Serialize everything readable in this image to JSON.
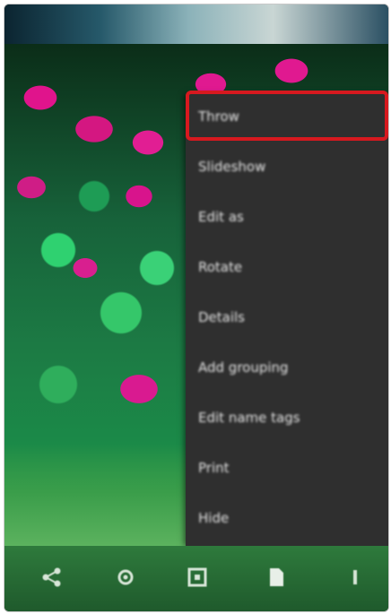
{
  "menu": {
    "items": [
      {
        "label": "Throw"
      },
      {
        "label": "Slideshow"
      },
      {
        "label": "Edit as"
      },
      {
        "label": "Rotate"
      },
      {
        "label": "Details"
      },
      {
        "label": "Add grouping"
      },
      {
        "label": "Edit name tags"
      },
      {
        "label": "Print"
      },
      {
        "label": "Hide"
      }
    ]
  },
  "bottom_bar": {
    "icons": [
      "share-icon",
      "settings-icon",
      "edit-icon",
      "file-icon",
      "more-icon"
    ]
  },
  "colors": {
    "menu_bg": "#2f2f2f",
    "highlight": "#d7191f",
    "menu_text": "#e6e6e6"
  }
}
